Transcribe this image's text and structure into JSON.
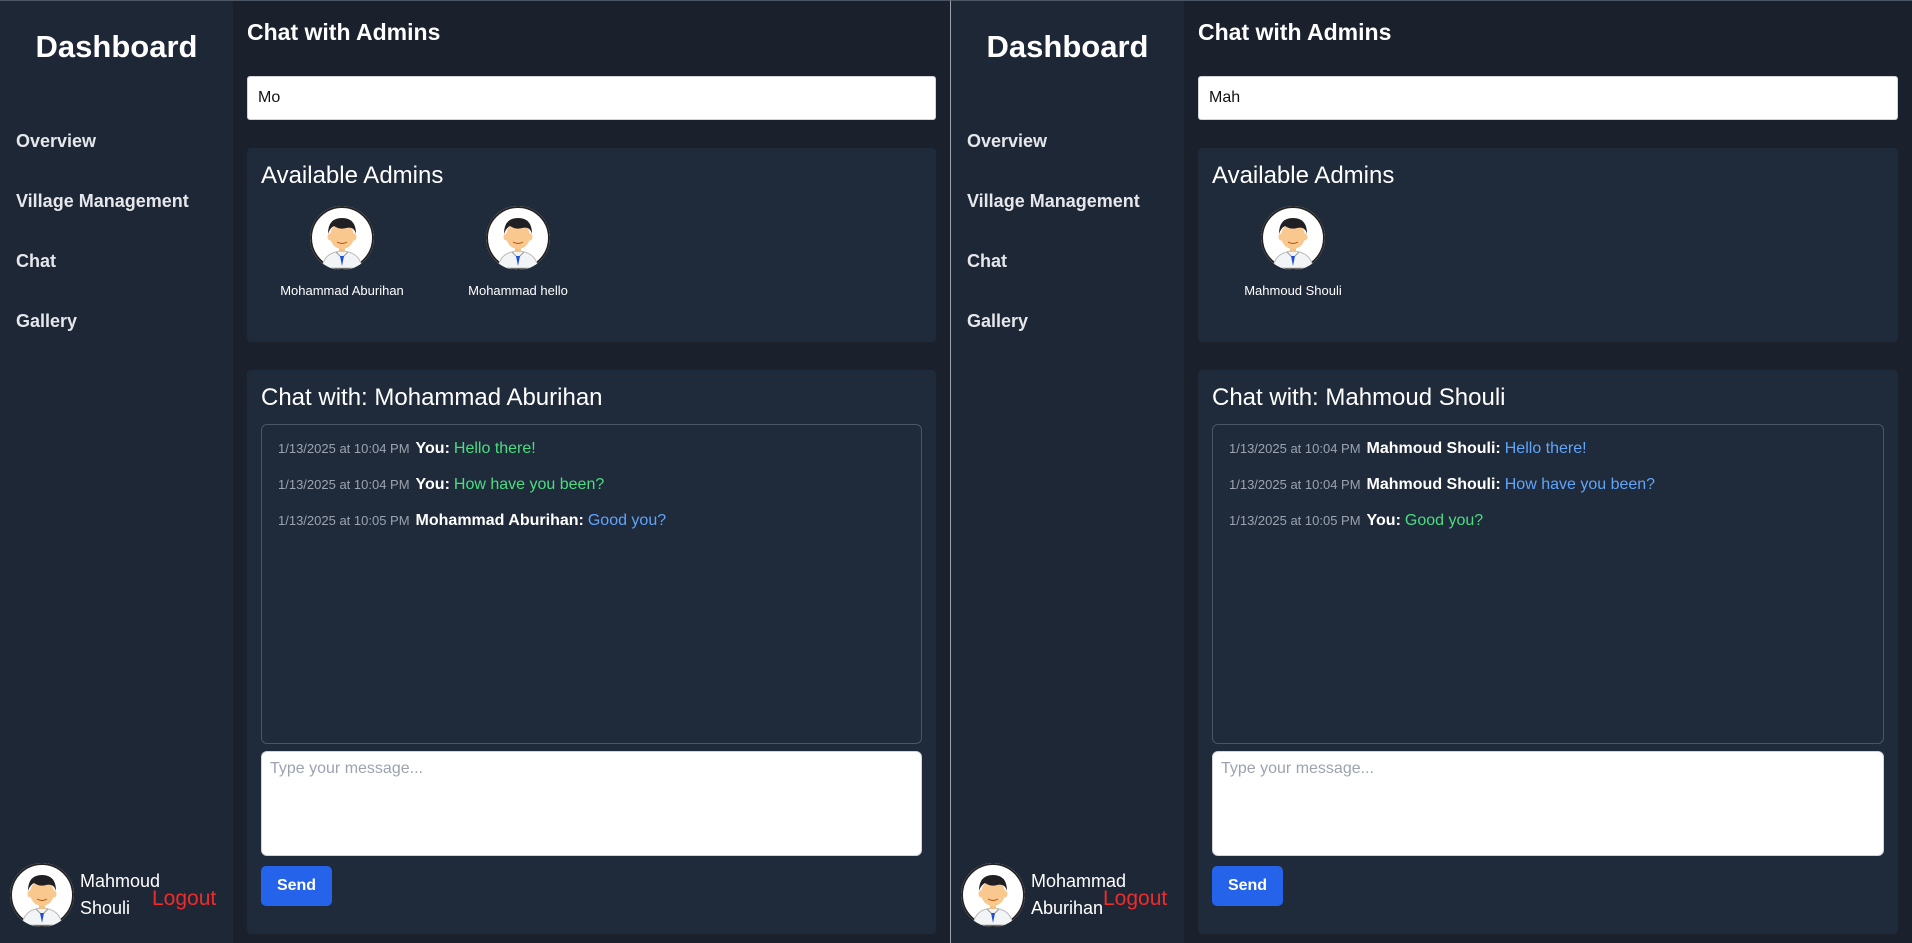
{
  "left": {
    "sidebar": {
      "brand": "Dashboard",
      "nav": [
        "Overview",
        "Village Management",
        "Chat",
        "Gallery"
      ],
      "user_first": "Mahmoud",
      "user_last": "Shouli",
      "logout": "Logout"
    },
    "main": {
      "title": "Chat with Admins",
      "search_value": "Mo",
      "admins_heading": "Available Admins",
      "admins": [
        "Mohammad Aburihan",
        "Mohammad hello"
      ],
      "chat_heading": "Chat with: Mohammad Aburihan",
      "messages": [
        {
          "time": "1/13/2025 at 10:04 PM",
          "sender": "You:",
          "text": "Hello there!",
          "self": true
        },
        {
          "time": "1/13/2025 at 10:04 PM",
          "sender": "You:",
          "text": "How have you been?",
          "self": true
        },
        {
          "time": "1/13/2025 at 10:05 PM",
          "sender": "Mohammad Aburihan:",
          "text": "Good you?",
          "self": false
        }
      ],
      "message_placeholder": "Type your message...",
      "send_label": "Send"
    }
  },
  "right": {
    "sidebar": {
      "brand": "Dashboard",
      "nav": [
        "Overview",
        "Village Management",
        "Chat",
        "Gallery"
      ],
      "user_first": "Mohammad",
      "user_last": "Aburihan",
      "logout": "Logout"
    },
    "main": {
      "title": "Chat with Admins",
      "search_value": "Mah",
      "admins_heading": "Available Admins",
      "admins": [
        "Mahmoud Shouli"
      ],
      "chat_heading": "Chat with: Mahmoud Shouli",
      "messages": [
        {
          "time": "1/13/2025 at 10:04 PM",
          "sender": "Mahmoud Shouli:",
          "text": "Hello there!",
          "self": false
        },
        {
          "time": "1/13/2025 at 10:04 PM",
          "sender": "Mahmoud Shouli:",
          "text": "How have you been?",
          "self": false
        },
        {
          "time": "1/13/2025 at 10:05 PM",
          "sender": "You:",
          "text": "Good you?",
          "self": true
        }
      ],
      "message_placeholder": "Type your message...",
      "send_label": "Send"
    }
  },
  "colors": {
    "self_text": "#4ade80",
    "other_text": "#60a5fa",
    "logout": "#ef2b2b",
    "send_button": "#2563eb"
  },
  "icons": {
    "avatar": "user-avatar-icon"
  }
}
